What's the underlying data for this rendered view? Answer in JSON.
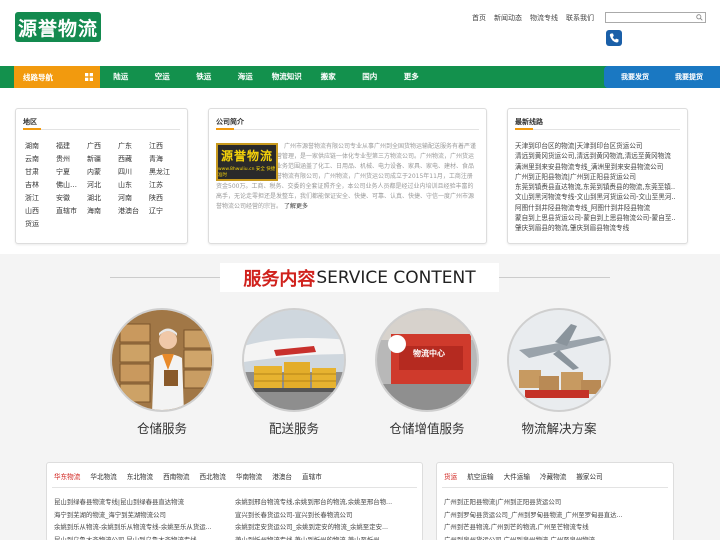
{
  "header": {
    "logo_text": "源誉物流",
    "topnav": [
      "首页",
      "新闻动态",
      "物流专线",
      "联系我们"
    ],
    "search_placeholder": ""
  },
  "mainnav": {
    "title": "线路导航",
    "items": [
      "陆运",
      "空运",
      "铁运",
      "海运",
      "物流知识",
      "搬家",
      "国内",
      "更多"
    ],
    "right": [
      "我要发货",
      "我要提货"
    ]
  },
  "regions": {
    "title": "地区",
    "items": [
      "湖南",
      "福建",
      "广西",
      "广东",
      "江西",
      "云南",
      "贵州",
      "新疆",
      "西藏",
      "青海",
      "甘肃",
      "宁夏",
      "内蒙",
      "四川",
      "黑龙江",
      "吉林",
      "佛山…",
      "河北",
      "山东",
      "江苏",
      "浙江",
      "安徽",
      "湖北",
      "河南",
      "陕西",
      "山西",
      "直辖市",
      "海南",
      "港澳台",
      "辽宁",
      "货运"
    ]
  },
  "company": {
    "title": "公司简介",
    "img_logo": "源誉物流",
    "img_sub": "www.8hwuliu.cn 安全 快捷 准时",
    "text": "广州市源誉物流有限公司专业从事广州到全国货物运输配送服务有着严谨的运输组织、完善的经营管理，是一家供应链一体化专业型第三方物流公司。广州物流，广州货运公司，广州物流公司，业务范围涵盖了化工、日用品、机械、电力设备、家具、家电、建材、食品等众多行业。广州市源誉物流有限公司，广州物流，广州货运公司成立于2015年11月，工商注册资金500万。工商、税务、交委的全套证照齐全，本公司业务人员都是经过业内培训且经验丰富的高手，无论走零担还是发整车，我们都能保证安全、快捷、可靠、认真、快捷、守信一度广州市源誉物流公司经营的宗旨。",
    "more": "了解更多"
  },
  "routes": {
    "title": "最新线路",
    "items": [
      "天津到印台区的物流|天津到印台区货运公司",
      "清远到黄冈货运公司,清远到黄冈物流,清远至黄冈物流",
      "满洲里到来安县物流专线_满洲里到来安县物流公司",
      "广州到正阳县物流|广州到正阳县货运公司",
      "东莞到镇赉县直达物流,东莞到镇赉县的物流,东莞至镇...",
      "文山到黑河物流专线-文山到黑河货运公司-文山至黑河...",
      "阿图什到井陉县物流专线_阿图什到井陉县物流",
      "蒙自到上思县货运公司-蒙自到上思县物流公司-蒙自至...",
      "肇庆到眉县的物流,肇庆到眉县物流专线"
    ]
  },
  "service": {
    "title_cn": "服务内容",
    "title_en": "SERVICE CONTENT",
    "items": [
      "仓储服务",
      "配送服务",
      "仓储增值服务",
      "物流解决方案"
    ],
    "sign_text": "物流中心"
  },
  "bottom_left": {
    "tabs": [
      "华东物流",
      "华北物流",
      "东北物流",
      "西南物流",
      "西北物流",
      "华南物流",
      "港澳台",
      "直辖市"
    ],
    "col1": [
      "昆山到绿春县物流专线|昆山到绿春县直达物流",
      "海宁到芜湖的物流_海宁到芜湖物流公司",
      "余姚到乐从物流-余姚到乐从物流专线-余姚至乐从货运...",
      "昆山到乌鲁木齐物流公司 昆山到乌鲁木齐物流专线"
    ],
    "col2": [
      "余姚到邢台物流专线,余姚到邢台的物流,余姚至邢台物...",
      "宣兴到长春货运公司-宣兴到长春物流公司",
      "余姚到定安货运公司_余姚到定安的物流_余姚至定安...",
      "萧山到忻州物流专线 萧山到忻州的物流 萧山至忻州..."
    ]
  },
  "bottom_right": {
    "tabs": [
      "货运",
      "航空运输",
      "大件运输",
      "冷藏物流",
      "搬家公司"
    ],
    "col1": [
      "广州到正阳县物流|广州到正阳县货运公司",
      "广州到罗甸县货运公司_广州到罗甸县物流_广州至罗甸县直达...",
      "广州到芒县物流,广州到芒的物流,广州至芒物流专线",
      "广州到泉州货运公司,广州到泉州物流,广州至泉州物流"
    ]
  },
  "colors": {
    "green": "#13914d",
    "orange": "#f29a0e",
    "blue": "#1a78c2",
    "red": "#d0211c"
  }
}
